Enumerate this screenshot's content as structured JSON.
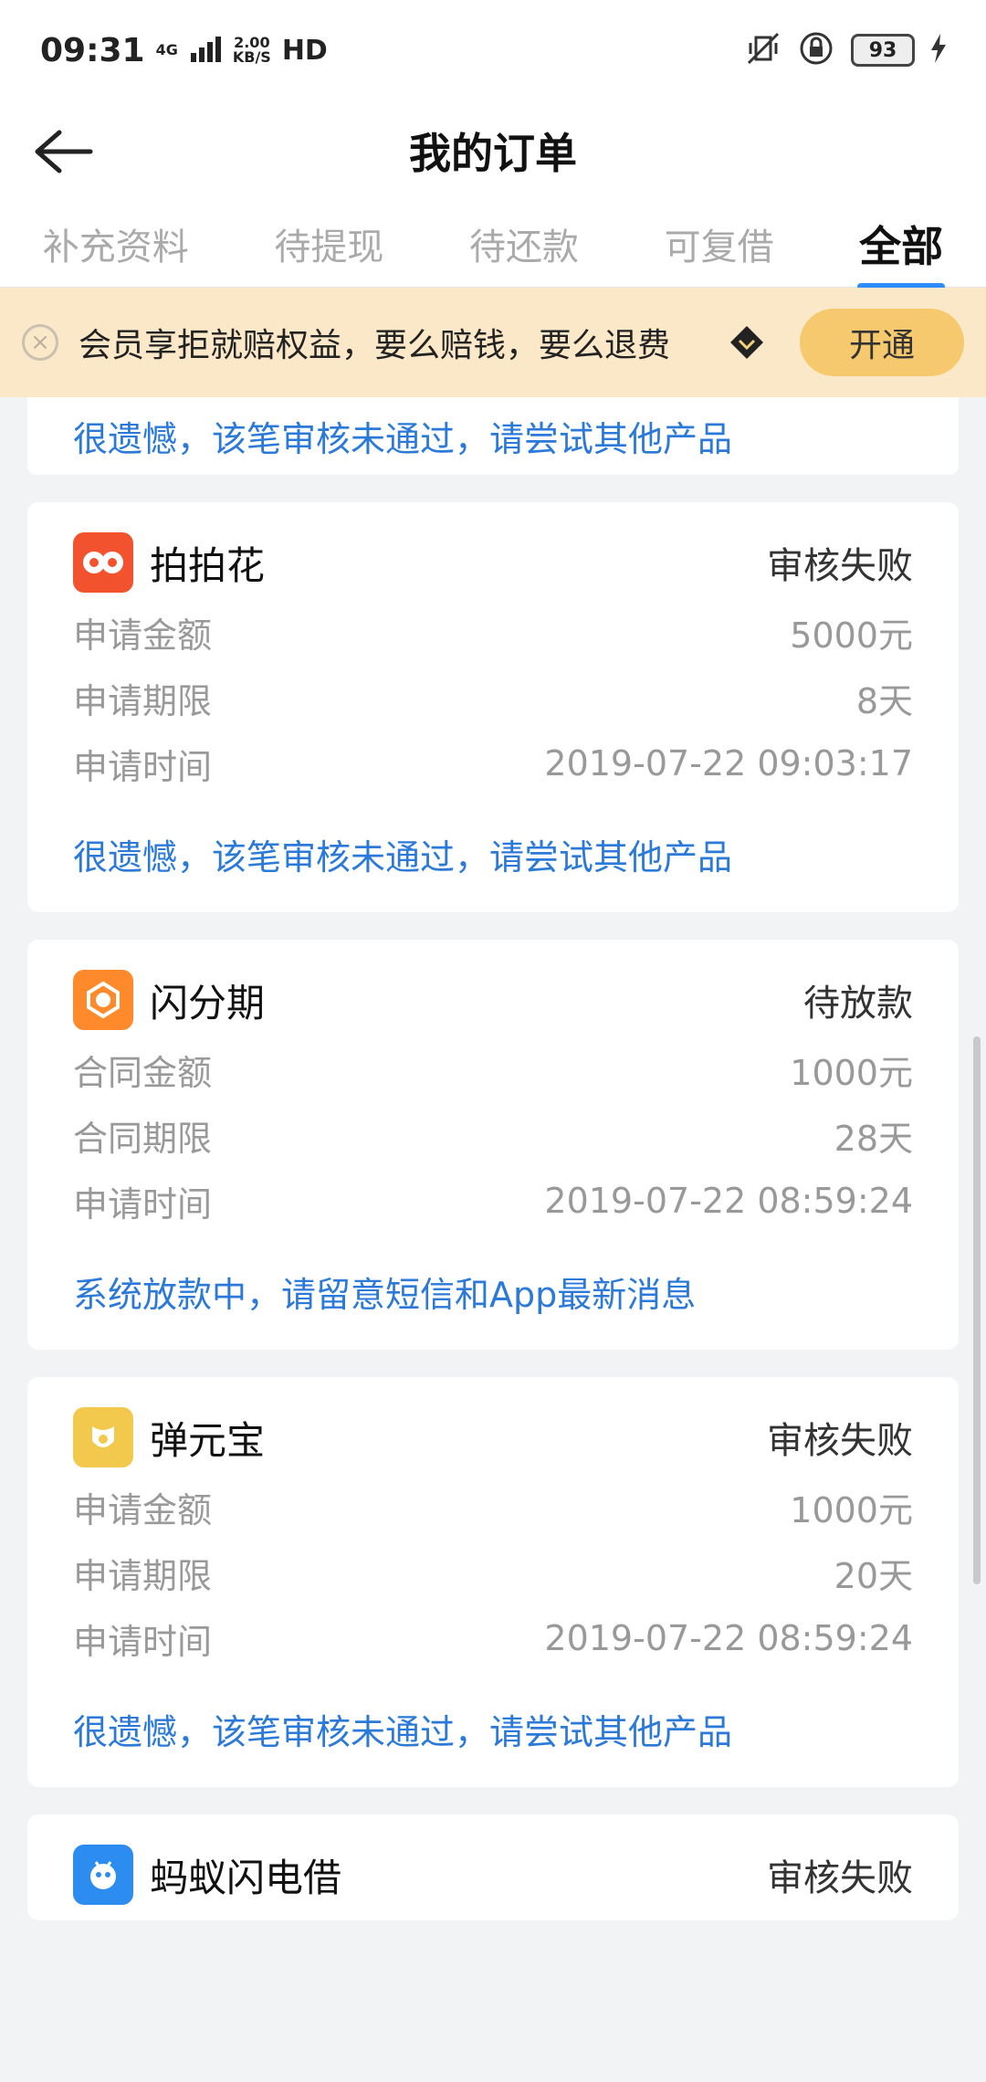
{
  "status_bar": {
    "time": "09:31",
    "network": "4G",
    "speed_value": "2.00",
    "speed_unit": "KB/S",
    "hd": "HD",
    "battery": "93"
  },
  "header": {
    "title": "我的订单"
  },
  "tabs": [
    {
      "label": "补充资料",
      "active": false
    },
    {
      "label": "待提现",
      "active": false
    },
    {
      "label": "待还款",
      "active": false
    },
    {
      "label": "可复借",
      "active": false
    },
    {
      "label": "全部",
      "active": true
    }
  ],
  "banner": {
    "text": "会员享拒就赔权益，要么赔钱，要么退费",
    "button": "开通"
  },
  "top_stub_message": "很遗憾，该笔审核未通过，请尝试其他产品",
  "orders": [
    {
      "brand": "拍拍花",
      "status": "审核失败",
      "logo_color": "#f2532e",
      "rows": [
        {
          "label": "申请金额",
          "value": "5000元"
        },
        {
          "label": "申请期限",
          "value": "8天"
        },
        {
          "label": "申请时间",
          "value": "2019-07-22 09:03:17"
        }
      ],
      "message": "很遗憾，该笔审核未通过，请尝试其他产品"
    },
    {
      "brand": "闪分期",
      "status": "待放款",
      "logo_color": "#ff8a2b",
      "rows": [
        {
          "label": "合同金额",
          "value": "1000元"
        },
        {
          "label": "合同期限",
          "value": "28天"
        },
        {
          "label": "申请时间",
          "value": "2019-07-22 08:59:24"
        }
      ],
      "message": "系统放款中，请留意短信和App最新消息"
    },
    {
      "brand": "弹元宝",
      "status": "审核失败",
      "logo_color": "#f2c94c",
      "rows": [
        {
          "label": "申请金额",
          "value": "1000元"
        },
        {
          "label": "申请期限",
          "value": "20天"
        },
        {
          "label": "申请时间",
          "value": "2019-07-22 08:59:24"
        }
      ],
      "message": "很遗憾，该笔审核未通过，请尝试其他产品"
    },
    {
      "brand": "蚂蚁闪电借",
      "status": "审核失败",
      "logo_color": "#2d8cf0",
      "rows": [],
      "message": ""
    }
  ]
}
